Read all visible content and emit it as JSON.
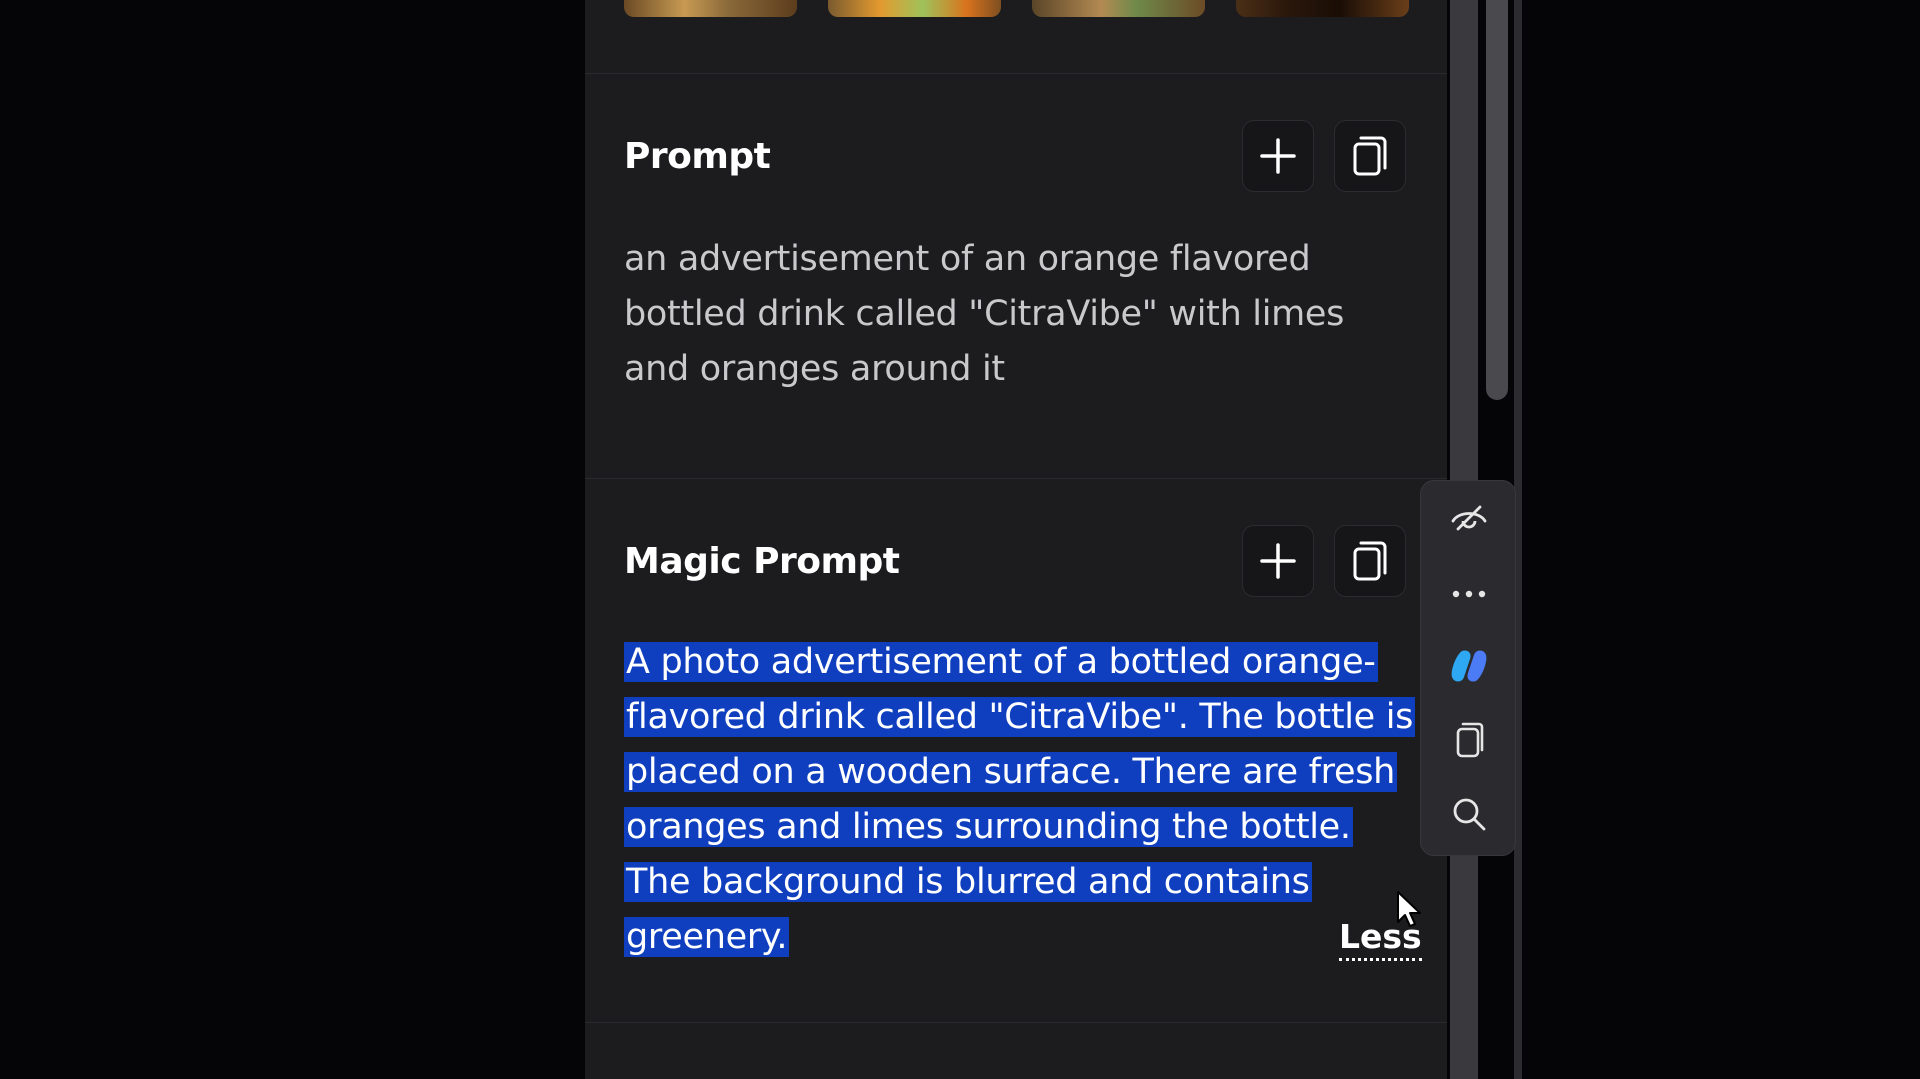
{
  "prompt_section": {
    "title": "Prompt",
    "text": "an advertisement of an orange flavored bottled drink called \"CitraVibe\" with limes and oranges around it"
  },
  "magic_prompt_section": {
    "title": "Magic Prompt",
    "text": "A photo advertisement of a bottled orange-flavored drink called \"CitraVibe\". The bottle is placed on a wooden surface. There are fresh oranges and limes surrounding the bottle. The background is blurred and contains greenery.",
    "less_label": "Less"
  },
  "buttons": {
    "add_icon": "plus-icon",
    "copy_icon": "copy-icon"
  },
  "floating_toolbar": {
    "items": [
      "eye-off-icon",
      "more-icon",
      "copilot-icon",
      "copy-icon",
      "search-icon"
    ]
  },
  "colors": {
    "panel_bg": "#1c1c1f",
    "selection": "#0f3fbf",
    "copilot_blue": "#2ea8f2"
  }
}
